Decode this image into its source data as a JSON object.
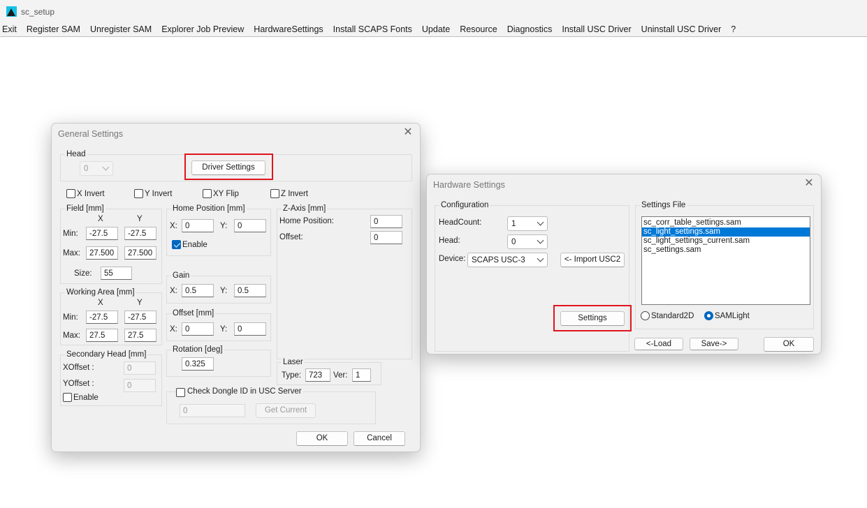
{
  "app": {
    "title": "sc_setup"
  },
  "menu": [
    "Exit",
    "Register SAM",
    "Unregister SAM",
    "Explorer Job Preview",
    "HardwareSettings",
    "Install SCAPS Fonts",
    "Update",
    "Resource",
    "Diagnostics",
    "Install USC Driver",
    "Uninstall USC Driver",
    "?"
  ],
  "general": {
    "title": "General Settings",
    "close": "✕",
    "head": {
      "group": "Head",
      "value": "0",
      "driver_button": "Driver Settings"
    },
    "checks": {
      "x_invert": "X Invert",
      "y_invert": "Y Invert",
      "xy_flip": "XY Flip",
      "z_invert": "Z Invert"
    },
    "field": {
      "group": "Field [mm]",
      "col_x": "X",
      "col_y": "Y",
      "min_label": "Min:",
      "min_x": "-27.5",
      "min_y": "-27.5",
      "max_label": "Max:",
      "max_x": "27.500",
      "max_y": "27.500",
      "size_label": "Size:",
      "size": "55"
    },
    "working": {
      "group": "Working Area [mm]",
      "col_x": "X",
      "col_y": "Y",
      "min_label": "Min:",
      "min_x": "-27.5",
      "min_y": "-27.5",
      "max_label": "Max:",
      "max_x": "27.5",
      "max_y": "27.5"
    },
    "secondary": {
      "group": "Secondary Head [mm]",
      "xoffset_label": "XOffset :",
      "xoffset": "0",
      "yoffset_label": "YOffset :",
      "yoffset": "0",
      "enable": "Enable"
    },
    "home": {
      "group": "Home Position [mm]",
      "x_label": "X:",
      "x": "0",
      "y_label": "Y:",
      "y": "0",
      "enable": "Enable"
    },
    "gain": {
      "group": "Gain",
      "x_label": "X:",
      "x": "0.5",
      "y_label": "Y:",
      "y": "0.5"
    },
    "offset": {
      "group": "Offset [mm]",
      "x_label": "X:",
      "x": "0",
      "y_label": "Y:",
      "y": "0"
    },
    "rotation": {
      "group": "Rotation [deg]",
      "value": "0.325"
    },
    "zaxis": {
      "group": "Z-Axis [mm]",
      "home_label": "Home Position:",
      "home": "0",
      "offset_label": "Offset:",
      "offset": "0"
    },
    "laser": {
      "group": "Laser",
      "type_label": "Type:",
      "type": "723",
      "ver_label": "Ver:",
      "ver": "1"
    },
    "dongle": {
      "check_label": "Check Dongle ID in USC Server",
      "value": "0",
      "get_current": "Get Current"
    },
    "ok": "OK",
    "cancel": "Cancel"
  },
  "hardware": {
    "title": "Hardware Settings",
    "close": "✕",
    "config": {
      "group": "Configuration",
      "headcount_label": "HeadCount:",
      "headcount": "1",
      "head_label": "Head:",
      "head": "0",
      "device_label": "Device:",
      "device": "SCAPS USC-3",
      "import": "<- Import USC2",
      "settings": "Settings"
    },
    "files": {
      "group": "Settings File",
      "items": [
        "sc_corr_table_settings.sam",
        "sc_light_settings.sam",
        "sc_light_settings_current.sam",
        "sc_settings.sam"
      ],
      "selected_index": 1,
      "standard2d": "Standard2D",
      "samlight": "SAMLight",
      "selected_mode": "SAMLight"
    },
    "load": "<-Load",
    "save": "Save->",
    "ok": "OK"
  },
  "colors": {
    "highlight": "#e0141b",
    "selection": "#0078d7",
    "dialog_bg": "#f0f0f0",
    "accent": "#0067c0"
  },
  "icons": {
    "app": "sc-setup-app-icon",
    "close": "close-icon",
    "dropdown": "chevron-down-icon"
  }
}
